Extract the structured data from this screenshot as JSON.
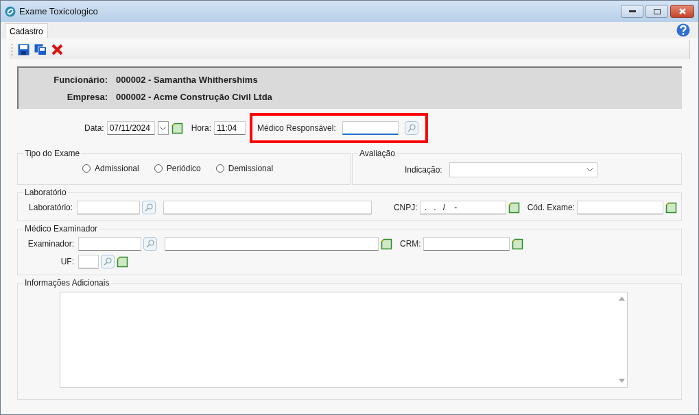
{
  "window": {
    "title": "Exame Toxicologico"
  },
  "tabs": [
    {
      "label": "Cadastro",
      "selected": true
    }
  ],
  "header": {
    "fields": [
      {
        "label": "Funcionário:",
        "value": "000002 - Samantha Whithershims"
      },
      {
        "label": "Empresa:",
        "value": "000002 - Acme Construção Civil Ltda"
      }
    ]
  },
  "top_row": {
    "data": {
      "label": "Data:",
      "value": "07/11/2024"
    },
    "hora": {
      "label": "Hora:",
      "value": "11:04"
    },
    "medico_responsavel": {
      "label": "Médico Responsável:",
      "focused": true,
      "highlighted": true
    }
  },
  "tipo_exame": {
    "title": "Tipo do Exame",
    "options": [
      {
        "label": "Admissional",
        "selected": false
      },
      {
        "label": "Periódico",
        "selected": false
      },
      {
        "label": "Demissional",
        "selected": false
      }
    ]
  },
  "avaliacao": {
    "title": "Avaliação",
    "indicacao": {
      "label": "Indicação:"
    }
  },
  "laboratorio": {
    "title": "Laboratório",
    "laboratorio": {
      "label": "Laboratório:"
    },
    "cnpj": {
      "label": "CNPJ:",
      "value": " .   .   /    -"
    },
    "cod_exame": {
      "label": "Cód. Exame:"
    }
  },
  "medico_examinador": {
    "title": "Médico Examinador",
    "examinador": {
      "label": "Examinador:"
    },
    "crm": {
      "label": "CRM:"
    },
    "uf": {
      "label": "UF:"
    }
  },
  "informacoes_adicionais": {
    "title": "Informações Adicionais"
  }
}
